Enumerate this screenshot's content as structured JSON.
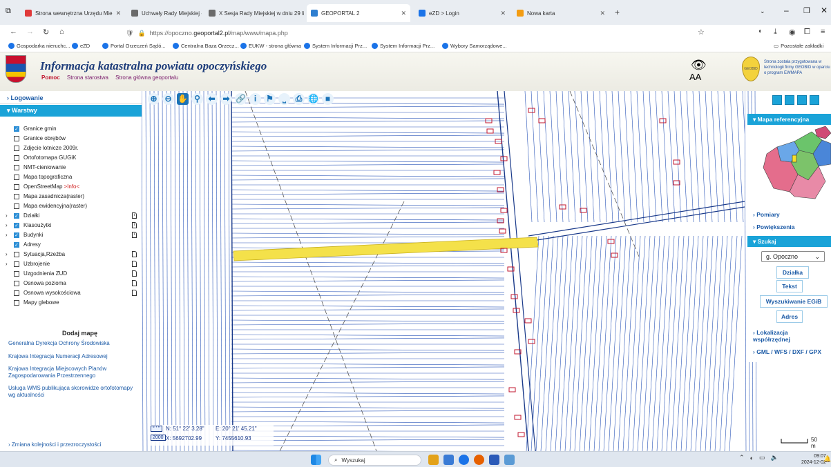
{
  "browser": {
    "tabs": [
      {
        "label": "Strona wewnętrzna Urzędu Mie",
        "color": "#e03a3a",
        "active": false
      },
      {
        "label": "Uchwały Rady Miejskiej - Biule",
        "color": "#6a6a6a",
        "active": false
      },
      {
        "label": "X Sesja Rady Miejskiej w dniu 29 li",
        "color": "#6a6a6a",
        "active": false
      },
      {
        "label": "GEOPORTAL 2",
        "color": "#2f7fd0",
        "active": true
      },
      {
        "label": "eZD > Login",
        "color": "#1a73e8",
        "active": false
      },
      {
        "label": "Nowa karta",
        "color": "#f39c12",
        "active": false
      }
    ],
    "url_prefix": "https://opoczno.",
    "url_domain": "geoportal2.pl",
    "url_path": "/map/www/mapa.php",
    "bookmarks": [
      {
        "label": "Gospodarka nieruchc..."
      },
      {
        "label": "eZD"
      },
      {
        "label": "Portal Orzeczeń Sądó..."
      },
      {
        "label": "Centralna Baza Orzecz..."
      },
      {
        "label": "EUKW - strona główna"
      },
      {
        "label": "System Informacji Prz..."
      },
      {
        "label": "System Informacji Prz..."
      },
      {
        "label": "Wybory Samorządowe..."
      }
    ],
    "other_bookmarks": "Pozostałe zakładki"
  },
  "header": {
    "title": "Informacja katastralna powiatu opoczyńskiego",
    "links": [
      "Pomoc",
      "Strona starostwa",
      "Strona główna geoportalu"
    ],
    "aa": "AA",
    "geobid_logo": "GEOBID",
    "geobid_text": "Strona została przygotowana w technologii firmy GEOBID w oparciu o program EWMAPA"
  },
  "sidebar": {
    "logowanie": "Logowanie",
    "warstwy": "Warstwy",
    "layers": [
      {
        "label": "Granice gmin",
        "checked": true,
        "expand": false,
        "doc": false
      },
      {
        "label": "Granice obrębów",
        "checked": false,
        "expand": false,
        "doc": false
      },
      {
        "label": "Zdjęcie lotnicze 2009r.",
        "checked": false,
        "expand": false,
        "doc": false
      },
      {
        "label": "Ortofotomapa GUGiK",
        "checked": false,
        "expand": false,
        "doc": false
      },
      {
        "label": "NMT-cieniowanie",
        "checked": false,
        "expand": false,
        "doc": false
      },
      {
        "label": "Mapa topograficzna",
        "checked": false,
        "expand": false,
        "doc": false
      },
      {
        "label": "OpenStreetMap",
        "checked": false,
        "expand": false,
        "doc": false,
        "info": ">Info<"
      },
      {
        "label": "Mapa zasadnicza(raster)",
        "checked": false,
        "expand": false,
        "doc": false
      },
      {
        "label": "Mapa ewidencyjna(raster)",
        "checked": false,
        "expand": false,
        "doc": false
      },
      {
        "label": "Działki",
        "checked": true,
        "expand": true,
        "doc": true
      },
      {
        "label": "Klasoużytki",
        "checked": true,
        "expand": true,
        "doc": true
      },
      {
        "label": "Budynki",
        "checked": true,
        "expand": true,
        "doc": true
      },
      {
        "label": "Adresy",
        "checked": true,
        "expand": false,
        "doc": false
      },
      {
        "label": "Sytuacja,Rzeźba",
        "checked": false,
        "expand": true,
        "doc": true
      },
      {
        "label": "Uzbrojenie",
        "checked": false,
        "expand": true,
        "doc": true
      },
      {
        "label": "Uzgodnienia ZUD",
        "checked": false,
        "expand": false,
        "doc": true
      },
      {
        "label": "Osnowa pozioma",
        "checked": false,
        "expand": false,
        "doc": true
      },
      {
        "label": "Osnowa wysokościowa",
        "checked": false,
        "expand": false,
        "doc": true
      },
      {
        "label": "Mapy glebowe",
        "checked": false,
        "expand": false,
        "doc": false
      }
    ],
    "dodaj_mape": "Dodaj mapę",
    "links": [
      "Generalna Dyrekcja Ochrony Środowiska",
      "Krajowa Integracja Numeracji Adresowej",
      "Krajowa Integracja Miejscowych Planów Zagospodarowania Przestrzennego",
      "Usługa WMS publikująca skorowidze ortofotomapy wg aktualności"
    ],
    "zmiana": "Zmiana kolejności i przezroczystości"
  },
  "rightpanel": {
    "mapa_ref": "Mapa referencyjna",
    "pomiary": "Pomiary",
    "powiekszenia": "Powiększenia",
    "szukaj": "Szukaj",
    "select_value": "g. Opoczno",
    "buttons": [
      "Działka",
      "Tekst",
      "Wyszukiwanie EGiB",
      "Adres"
    ],
    "lokalizacja": "Lokalizacja współrzędnej",
    "gml": "GML / WFS / DXF / GPX"
  },
  "coords": {
    "wgs_label": "° ' \"",
    "n": "N: 51° 22' 3.28\"",
    "e": "E: 20° 21' 45.21\"",
    "sys": "2000",
    "x": "X: 5692702.99",
    "y": "Y: 7455610.93"
  },
  "scale": "50 m",
  "taskbar": {
    "search": "Wyszukaj",
    "time": "09:07",
    "date": "2024-12-02"
  }
}
